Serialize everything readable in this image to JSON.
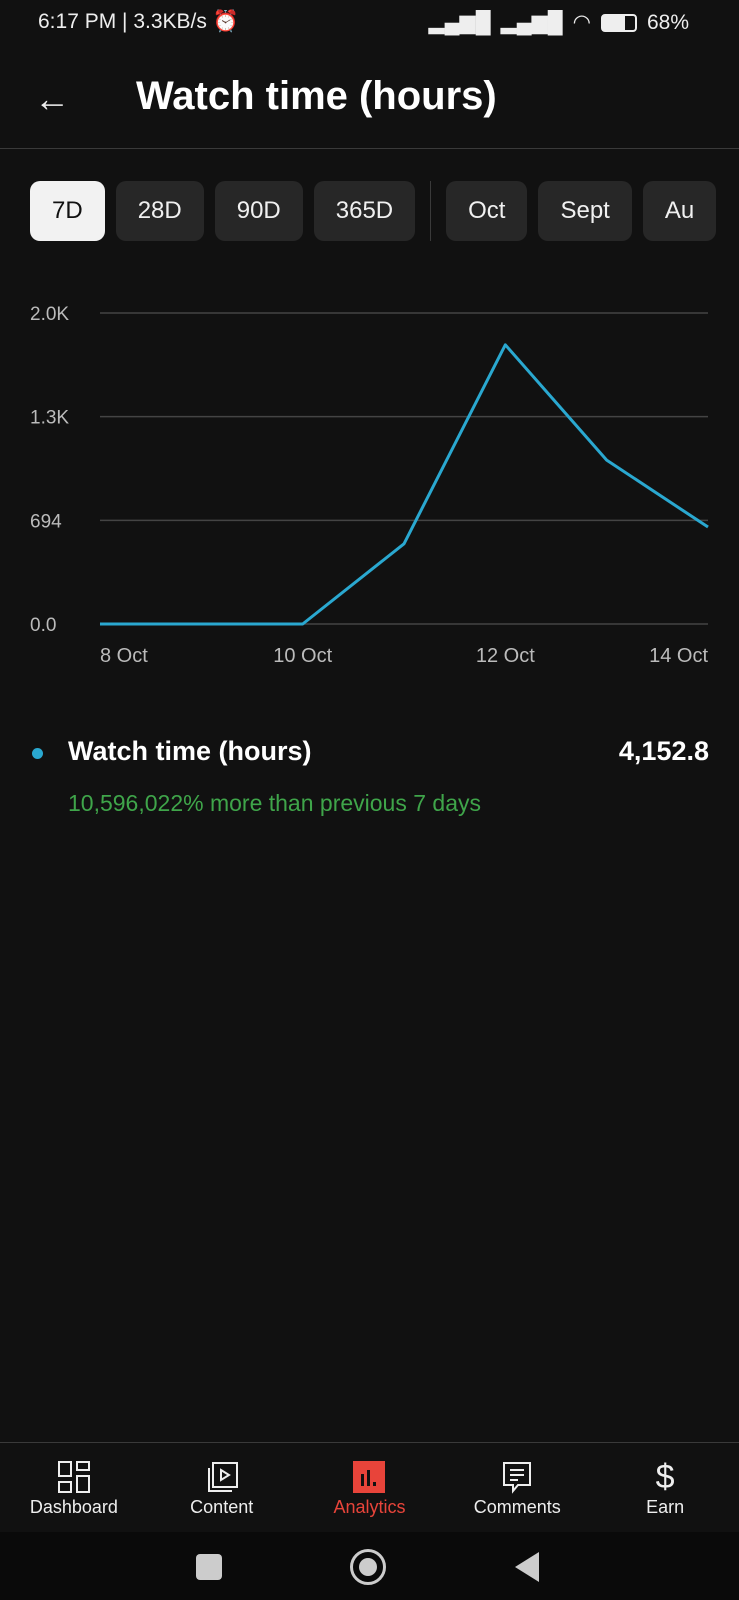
{
  "status_bar": {
    "time": "6:17 PM",
    "speed": "3.3KB/s",
    "battery": "68%"
  },
  "header": {
    "title": "Watch time (hours)"
  },
  "tabs": [
    {
      "label": "7D",
      "active": true
    },
    {
      "label": "28D"
    },
    {
      "label": "90D"
    },
    {
      "label": "365D"
    },
    {
      "label": "Oct"
    },
    {
      "label": "Sept"
    },
    {
      "label": "Au"
    }
  ],
  "chart_data": {
    "type": "line",
    "x": [
      "8 Oct",
      "9 Oct",
      "10 Oct",
      "11 Oct",
      "12 Oct",
      "13 Oct",
      "14 Oct"
    ],
    "values": [
      0,
      0,
      0,
      537,
      1869,
      1097,
      649
    ],
    "x_tick_labels": [
      "8 Oct",
      "10 Oct",
      "12 Oct",
      "14 Oct"
    ],
    "y_tick_labels": [
      "0.0",
      "694",
      "1.3K",
      "2.0K"
    ],
    "y_ticks": [
      0,
      694,
      1388,
      2082
    ],
    "ylim": [
      0,
      2082
    ],
    "grid": true,
    "color": "#2aa8d0"
  },
  "legend": {
    "name": "Watch time (hours)",
    "value": "4,152.8",
    "change": "10,596,022% more than previous 7 days",
    "color": "#2aa8d0",
    "change_color": "#3fa54a"
  },
  "bottom_nav": [
    {
      "label": "Dashboard",
      "icon": "dashboard-icon"
    },
    {
      "label": "Content",
      "icon": "content-icon"
    },
    {
      "label": "Analytics",
      "icon": "analytics-icon",
      "active": true
    },
    {
      "label": "Comments",
      "icon": "comments-icon"
    },
    {
      "label": "Earn",
      "icon": "dollar-icon"
    }
  ]
}
